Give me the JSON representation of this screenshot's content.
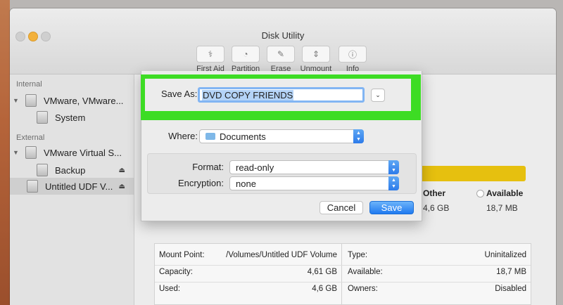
{
  "window": {
    "title": "Disk Utility"
  },
  "toolbar": [
    {
      "label": "First Aid",
      "icon": "first-aid-icon"
    },
    {
      "label": "Partition",
      "icon": "partition-icon"
    },
    {
      "label": "Erase",
      "icon": "erase-icon"
    },
    {
      "label": "Unmount",
      "icon": "unmount-icon"
    },
    {
      "label": "Info",
      "icon": "info-icon"
    }
  ],
  "sidebar": {
    "internal_header": "Internal",
    "external_header": "External",
    "items": [
      {
        "label": "VMware, VMware..."
      },
      {
        "label": "System"
      },
      {
        "label": "VMware Virtual S..."
      },
      {
        "label": "Backup"
      },
      {
        "label": "Untitled UDF V..."
      }
    ]
  },
  "usage": {
    "other_label": "Other",
    "other_value": "4,6 GB",
    "available_label": "Available",
    "available_value": "18,7 MB",
    "bar_color": "#e6c00f"
  },
  "info": {
    "rows": [
      {
        "k1": "Mount Point:",
        "v1": "/Volumes/Untitled UDF Volume",
        "k2": "Type:",
        "v2": "Uninitalized"
      },
      {
        "k1": "Capacity:",
        "v1": "4,61 GB",
        "k2": "Available:",
        "v2": "18,7 MB"
      },
      {
        "k1": "Used:",
        "v1": "4,6 GB",
        "k2": "Owners:",
        "v2": "Disabled"
      }
    ]
  },
  "dialog": {
    "save_as_label": "Save As:",
    "save_as_value": "DVD COPY FRIENDS",
    "where_label": "Where:",
    "where_value": "Documents",
    "format_label": "Format:",
    "format_value": "read-only",
    "encryption_label": "Encryption:",
    "encryption_value": "none",
    "cancel_label": "Cancel",
    "save_label": "Save",
    "highlight_color": "#3ddc24"
  }
}
